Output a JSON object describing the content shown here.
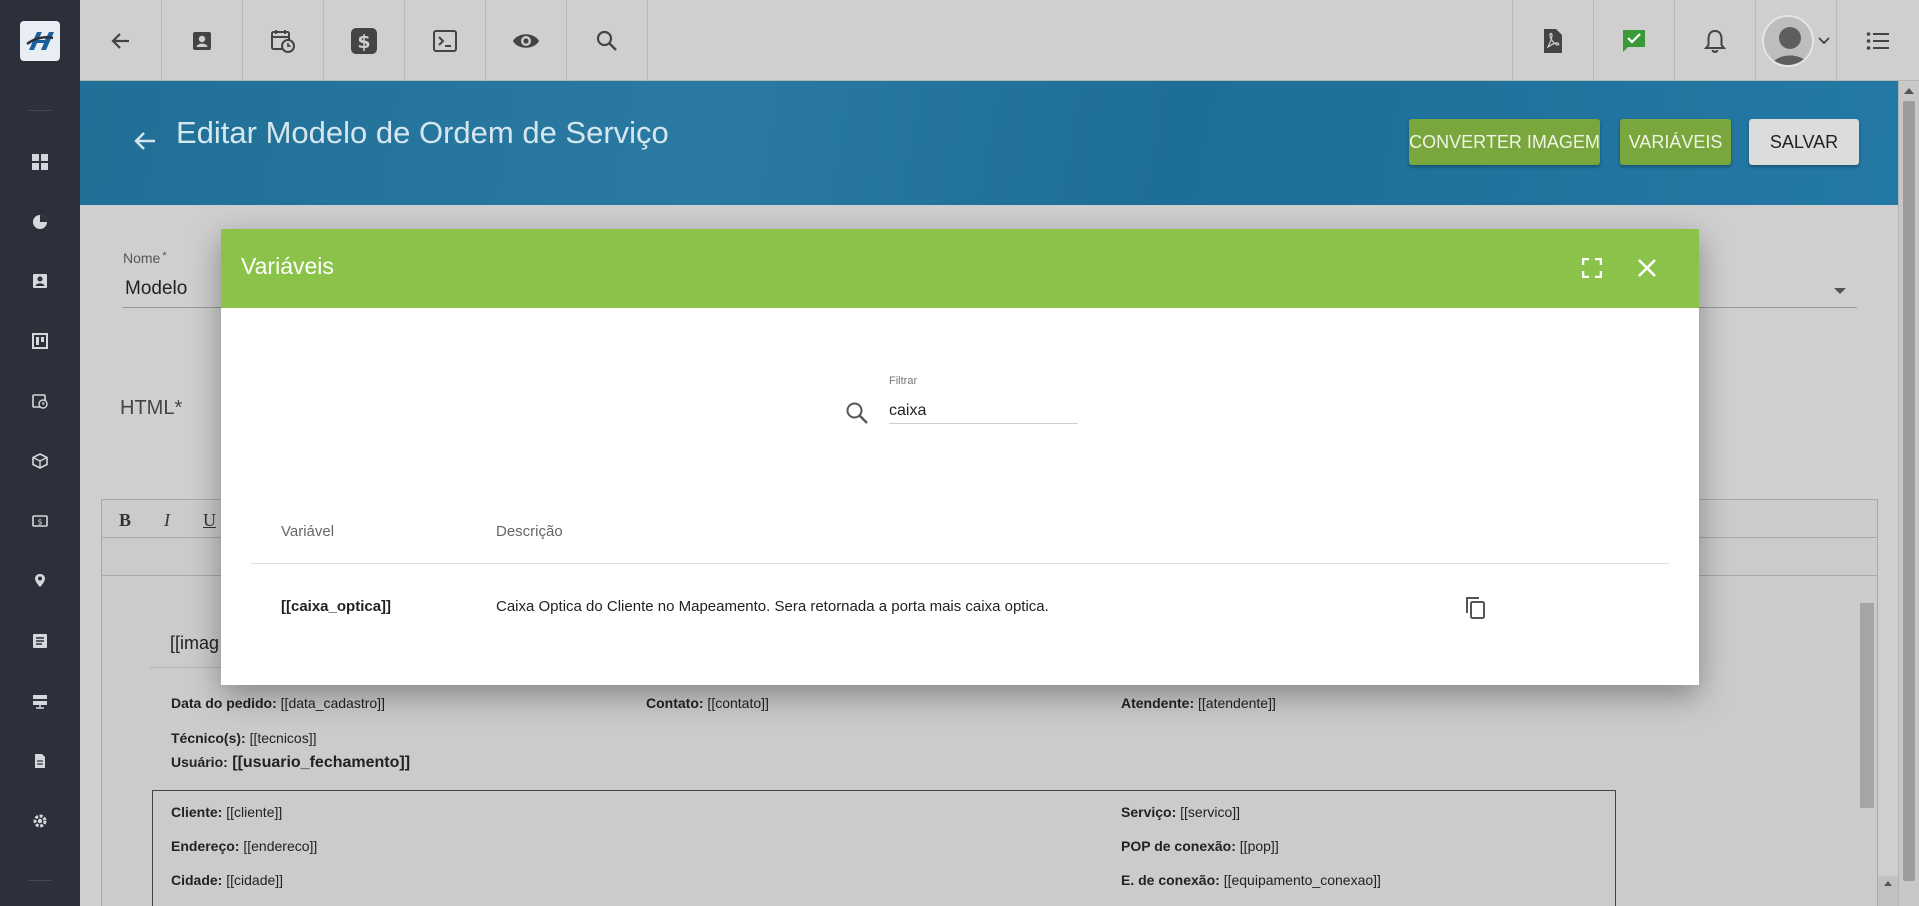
{
  "header": {
    "title": "Editar Modelo de Ordem de Serviço",
    "buttons": {
      "convert_image": "CONVERTER IMAGEM",
      "variables": "VARIÁVEIS",
      "save": "SALVAR"
    }
  },
  "form": {
    "name_label": "Nome",
    "name_required": "*",
    "name_value": "Modelo",
    "html_label": "HTML*"
  },
  "editor": {
    "toolbar": {
      "bold": "B",
      "italic": "I",
      "underline": "U"
    },
    "doc": {
      "image_var": "[[imag",
      "fields": [
        {
          "label": "Data do pedido:",
          "value": " [[data_cadastro]]"
        },
        {
          "label": "Contato:",
          "value": " [[contato]]"
        },
        {
          "label": "Atendente:",
          "value": " [[atendente]]"
        },
        {
          "label": "Técnico(s):",
          "value": " [[tecnicos]]"
        },
        {
          "label": "Usuário:",
          "value": " [[usuario_fechamento]]"
        },
        {
          "label": "Cliente:",
          "value": " [[cliente]]"
        },
        {
          "label": "Serviço:",
          "value": " [[servico]]"
        },
        {
          "label": "Endereço:",
          "value": " [[endereco]]"
        },
        {
          "label": "POP de conexão:",
          "value": " [[pop]]"
        },
        {
          "label": "Cidade:",
          "value": " [[cidade]]"
        },
        {
          "label": "E. de conexão:",
          "value": " [[equipamento_conexao]]"
        }
      ]
    }
  },
  "modal": {
    "title": "Variáveis",
    "filter_label": "Filtrar",
    "filter_value": "caixa",
    "columns": {
      "variable": "Variável",
      "description": "Descrição"
    },
    "rows": [
      {
        "variable": "[[caixa_optica]]",
        "description": "Caixa Optica do Cliente no Mapeamento. Sera retornada a porta mais caixa optica."
      }
    ]
  },
  "colors": {
    "sidebar": "#2b303a",
    "header": "#206f96",
    "accent_green": "#8bc34a",
    "button_green": "#7aa73d"
  },
  "icons": {
    "topbar": [
      "arrow-back-icon",
      "contact-card-icon",
      "calendar-clock-icon",
      "dollar-icon",
      "terminal-icon",
      "eye-icon",
      "search-icon",
      "pdf-icon",
      "chat-check-icon",
      "bell-icon",
      "avatar",
      "list-menu-icon"
    ]
  }
}
